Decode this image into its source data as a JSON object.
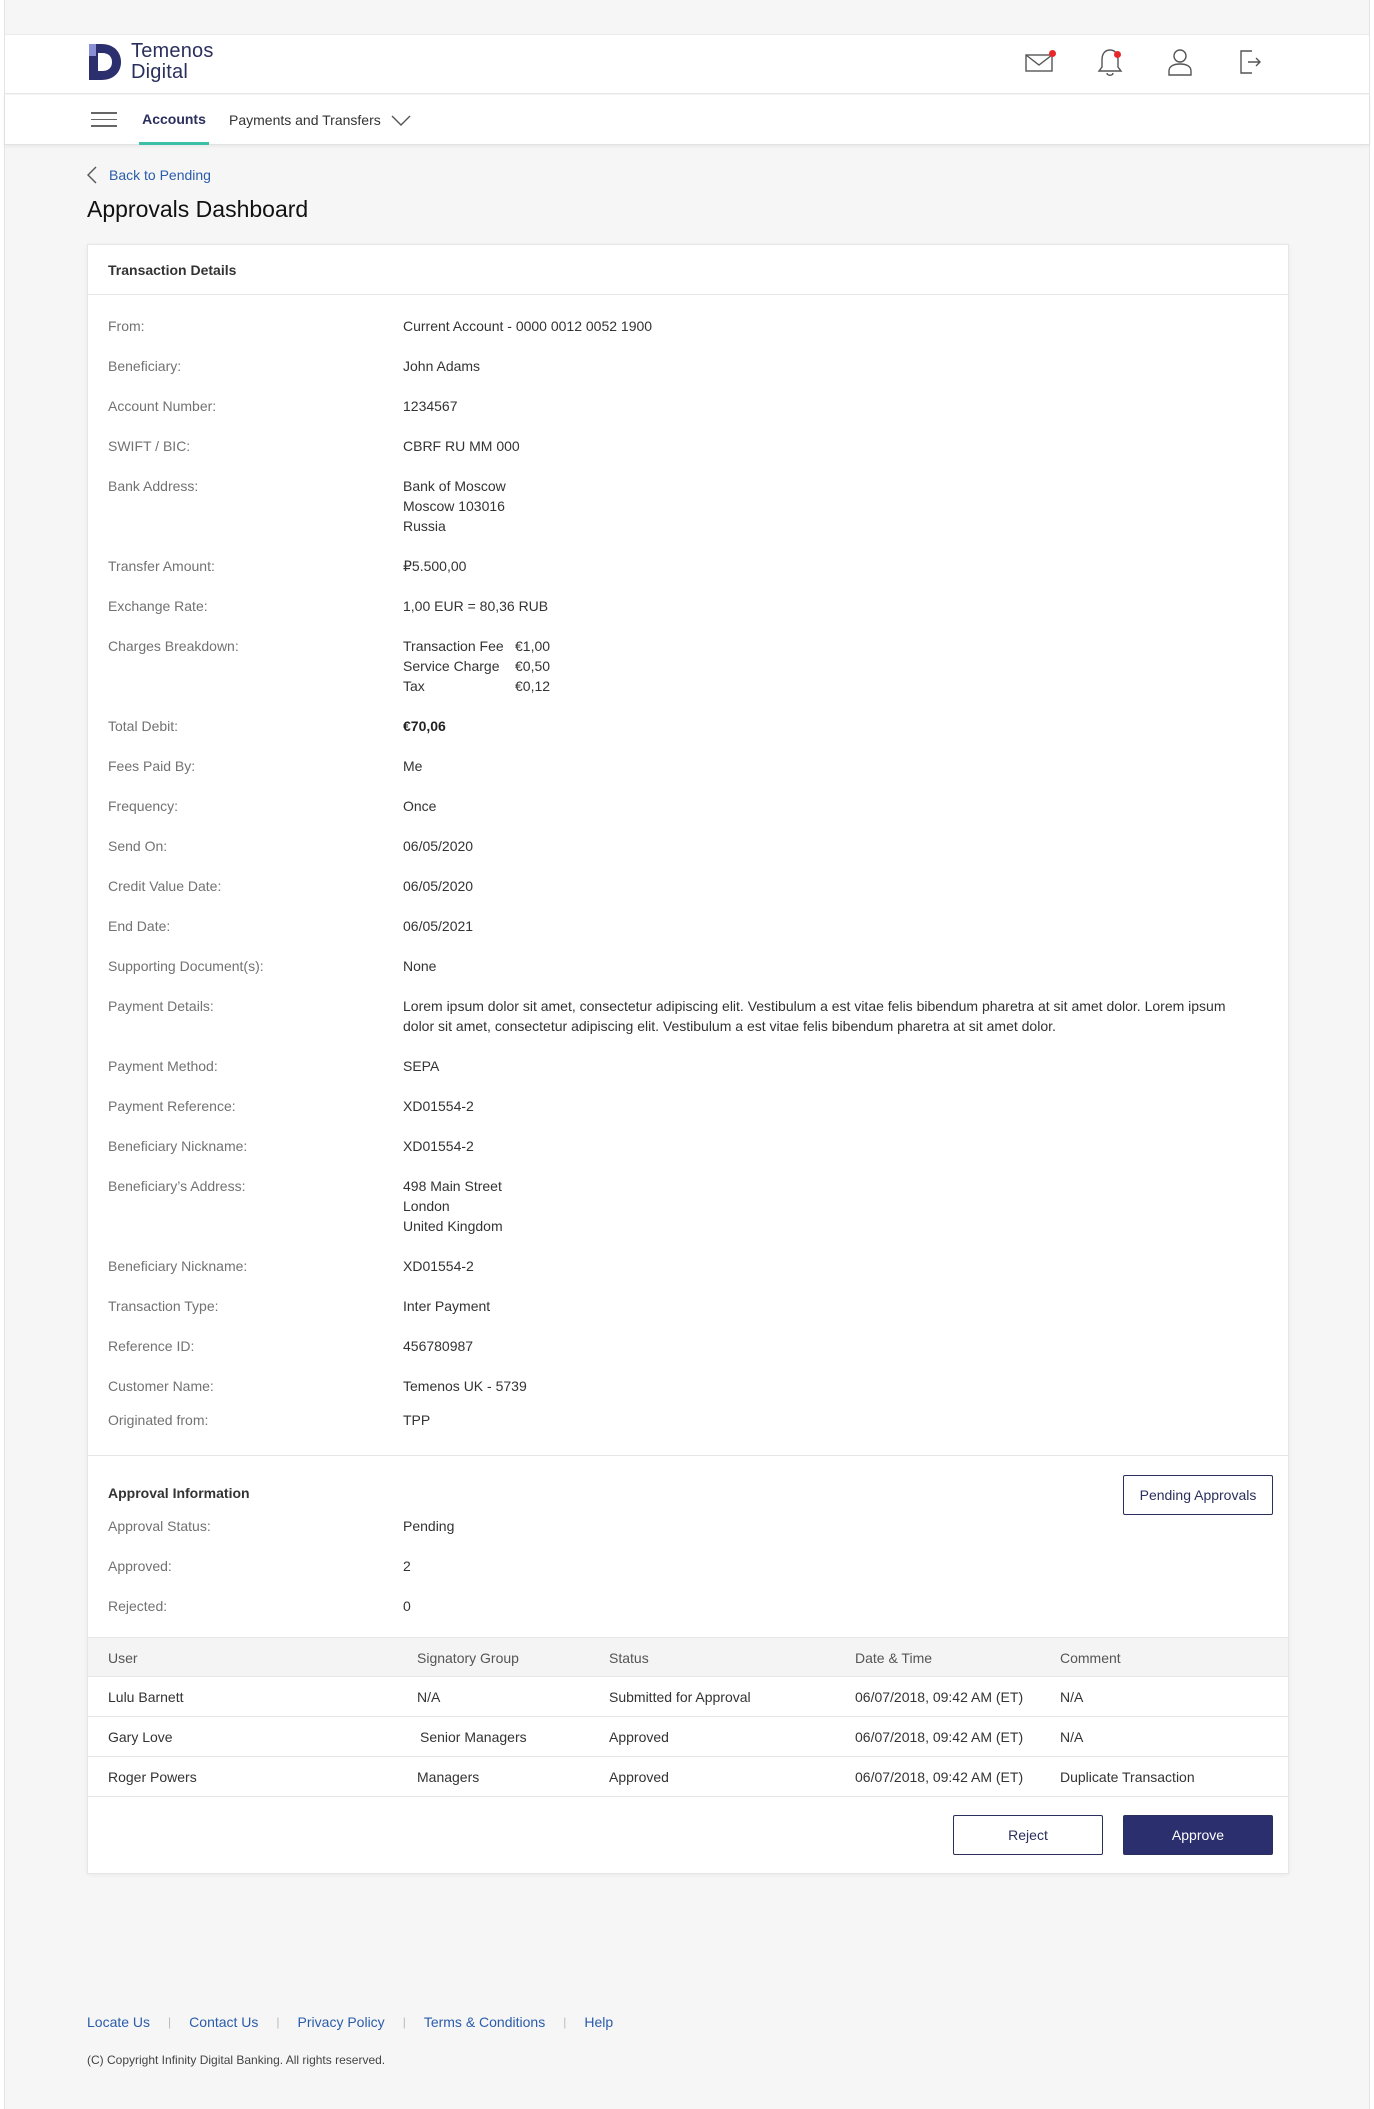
{
  "brand": {
    "line1": "Temenos",
    "line2": "Digital"
  },
  "header": {
    "icons": [
      "mail-icon",
      "notification-bell-icon",
      "user-profile-icon",
      "logout-icon"
    ],
    "alert_color": "#e8272b"
  },
  "nav": {
    "tabs": [
      {
        "label": "Accounts",
        "active": true
      },
      {
        "label": "Payments and Transfers",
        "active": false
      }
    ]
  },
  "back_link": "Back to Pending",
  "page_title": "Approvals Dashboard",
  "transaction": {
    "heading": "Transaction Details",
    "from": {
      "label": "From:",
      "value": "Current Account - 0000 0012  0052 1900"
    },
    "beneficiary": {
      "label": "Beneficiary:",
      "value": "John Adams"
    },
    "account_number": {
      "label": "Account Number:",
      "value": "1234567"
    },
    "swift": {
      "label": "SWIFT / BIC:",
      "value": "CBRF RU MM 000"
    },
    "bank_address": {
      "label": "Bank Address:",
      "lines": [
        "Bank of Moscow",
        "Moscow 103016",
        "Russia"
      ]
    },
    "transfer_amount": {
      "label": "Transfer Amount:",
      "value": "₽5.500,00"
    },
    "exchange_rate": {
      "label": "Exchange Rate:",
      "value": "1,00 EUR = 80,36 RUB"
    },
    "charges": {
      "label": "Charges Breakdown:",
      "items": [
        {
          "name": "Transaction Fee",
          "amount": "€1,00"
        },
        {
          "name": "Service Charge",
          "amount": "€0,50"
        },
        {
          "name": "Tax",
          "amount": "€0,12"
        }
      ]
    },
    "total_debit": {
      "label": "Total Debit:",
      "value": "€70,06"
    },
    "fees_paid_by": {
      "label": "Fees Paid By:",
      "value": "Me"
    },
    "frequency": {
      "label": "Frequency:",
      "value": "Once"
    },
    "send_on": {
      "label": "Send On:",
      "value": "06/05/2020"
    },
    "credit_value_date": {
      "label": "Credit Value Date:",
      "value": "06/05/2020"
    },
    "end_date": {
      "label": "End Date:",
      "value": "06/05/2021"
    },
    "supporting_docs": {
      "label": "Supporting Document(s):",
      "value": "None"
    },
    "payment_details": {
      "label": "Payment Details:",
      "value": "Lorem ipsum dolor sit amet, consectetur adipiscing elit. Vestibulum a est vitae felis bibendum pharetra at sit amet dolor. Lorem ipsum dolor sit amet, consectetur adipiscing elit. Vestibulum a est vitae felis bibendum pharetra at sit amet dolor."
    },
    "payment_method": {
      "label": "Payment Method:",
      "value": "SEPA"
    },
    "payment_reference": {
      "label": "Payment Reference:",
      "value": "XD01554-2"
    },
    "beneficiary_nickname": {
      "label": "Beneficiary Nickname:",
      "value": "XD01554-2"
    },
    "beneficiary_address": {
      "label": "Beneficiary’s Address:",
      "lines": [
        "498 Main Street",
        "London",
        "United Kingdom"
      ]
    },
    "beneficiary_nickname_2": {
      "label": "Beneficiary Nickname:",
      "value": "XD01554-2"
    },
    "transaction_type": {
      "label": "Transaction Type:",
      "value": "Inter Payment"
    },
    "reference_id": {
      "label": "Reference ID:",
      "value": "456780987"
    },
    "customer_name": {
      "label": "Customer Name:",
      "value": "Temenos UK - 5739"
    },
    "originated_from": {
      "label": "Originated from:",
      "value": "TPP"
    }
  },
  "approval": {
    "heading": "Approval Information",
    "pending_button": "Pending Approvals",
    "status": {
      "label": "Approval Status:",
      "value": "Pending"
    },
    "approved": {
      "label": "Approved:",
      "value": "2"
    },
    "rejected": {
      "label": "Rejected:",
      "value": "0"
    },
    "columns": [
      "User",
      "Signatory Group",
      "Status",
      "Date & Time",
      "Comment"
    ],
    "rows": [
      {
        "user": "Lulu Barnett",
        "group": "N/A",
        "status": "Submitted for Approval",
        "datetime": "06/07/2018, 09:42 AM (ET)",
        "comment": "N/A"
      },
      {
        "user": "Gary Love",
        "group": "Senior Managers",
        "status": "Approved",
        "datetime": "06/07/2018, 09:42 AM (ET)",
        "comment": "N/A"
      },
      {
        "user": "Roger Powers",
        "group": "Managers",
        "status": "Approved",
        "datetime": "06/07/2018, 09:42 AM (ET)",
        "comment": "Duplicate Transaction"
      }
    ]
  },
  "actions": {
    "reject": "Reject",
    "approve": "Approve"
  },
  "footer": {
    "links": [
      "Locate Us",
      "Contact Us",
      "Privacy Policy",
      "Terms & Conditions",
      "Help"
    ],
    "copyright": "(C) Copyright Infinity Digital Banking. All rights reserved."
  },
  "colors": {
    "brand_navy": "#2b2f6e",
    "accent_teal": "#3bc0a5",
    "link_blue": "#2a5caa"
  }
}
